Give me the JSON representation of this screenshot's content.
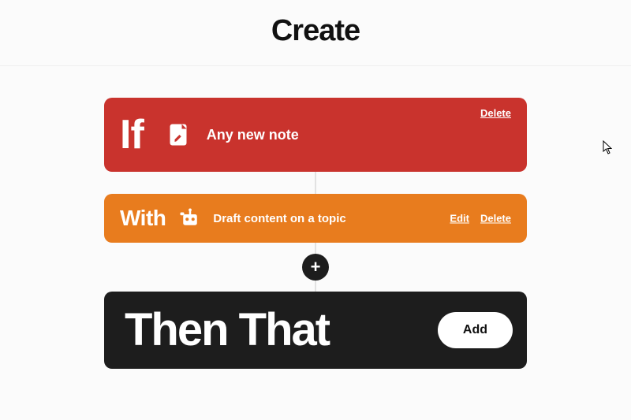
{
  "header": {
    "title": "Create"
  },
  "if_block": {
    "keyword": "If",
    "service_icon": "note-icon",
    "trigger_label": "Any new note",
    "delete_label": "Delete"
  },
  "with_block": {
    "keyword": "With",
    "service_icon": "ai-bot-icon",
    "trigger_label": "Draft content on a topic",
    "edit_label": "Edit",
    "delete_label": "Delete"
  },
  "then_block": {
    "keyword": "Then That",
    "add_label": "Add"
  },
  "plus_icon_glyph": "+"
}
